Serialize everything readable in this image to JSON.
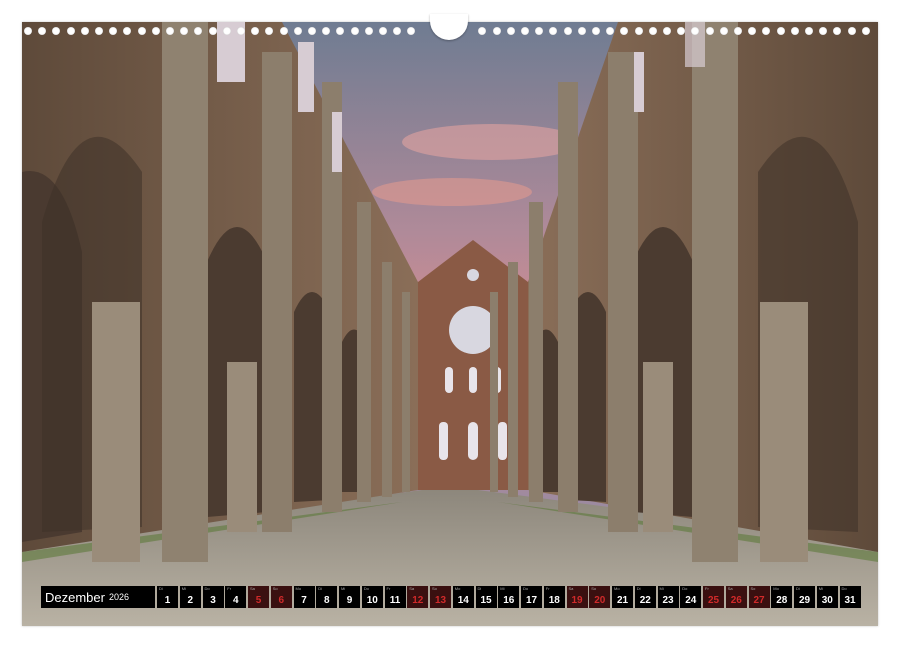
{
  "calendar": {
    "month": "Dezember",
    "year": "2026",
    "weekend_color": "#d12a2a",
    "days": [
      {
        "n": "1",
        "w": "Di",
        "we": false
      },
      {
        "n": "2",
        "w": "Mi",
        "we": false
      },
      {
        "n": "3",
        "w": "Do",
        "we": false
      },
      {
        "n": "4",
        "w": "Fr",
        "we": false
      },
      {
        "n": "5",
        "w": "Sa",
        "we": true
      },
      {
        "n": "6",
        "w": "So",
        "we": true
      },
      {
        "n": "7",
        "w": "Mo",
        "we": false
      },
      {
        "n": "8",
        "w": "Di",
        "we": false
      },
      {
        "n": "9",
        "w": "Mi",
        "we": false
      },
      {
        "n": "10",
        "w": "Do",
        "we": false
      },
      {
        "n": "11",
        "w": "Fr",
        "we": false
      },
      {
        "n": "12",
        "w": "Sa",
        "we": true
      },
      {
        "n": "13",
        "w": "So",
        "we": true
      },
      {
        "n": "14",
        "w": "Mo",
        "we": false
      },
      {
        "n": "15",
        "w": "Di",
        "we": false
      },
      {
        "n": "16",
        "w": "Mi",
        "we": false
      },
      {
        "n": "17",
        "w": "Do",
        "we": false
      },
      {
        "n": "18",
        "w": "Fr",
        "we": false
      },
      {
        "n": "19",
        "w": "Sa",
        "we": true
      },
      {
        "n": "20",
        "w": "So",
        "we": true
      },
      {
        "n": "21",
        "w": "Mo",
        "we": false
      },
      {
        "n": "22",
        "w": "Di",
        "we": false
      },
      {
        "n": "23",
        "w": "Mi",
        "we": false
      },
      {
        "n": "24",
        "w": "Do",
        "we": false
      },
      {
        "n": "25",
        "w": "Fr",
        "we": true
      },
      {
        "n": "26",
        "w": "Sa",
        "we": true
      },
      {
        "n": "27",
        "w": "So",
        "we": true
      },
      {
        "n": "28",
        "w": "Mo",
        "we": false
      },
      {
        "n": "29",
        "w": "Di",
        "we": false
      },
      {
        "n": "30",
        "w": "Mi",
        "we": false
      },
      {
        "n": "31",
        "w": "Do",
        "we": false
      }
    ]
  },
  "photo": {
    "subject": "abbey-ruin-nave-icon"
  }
}
